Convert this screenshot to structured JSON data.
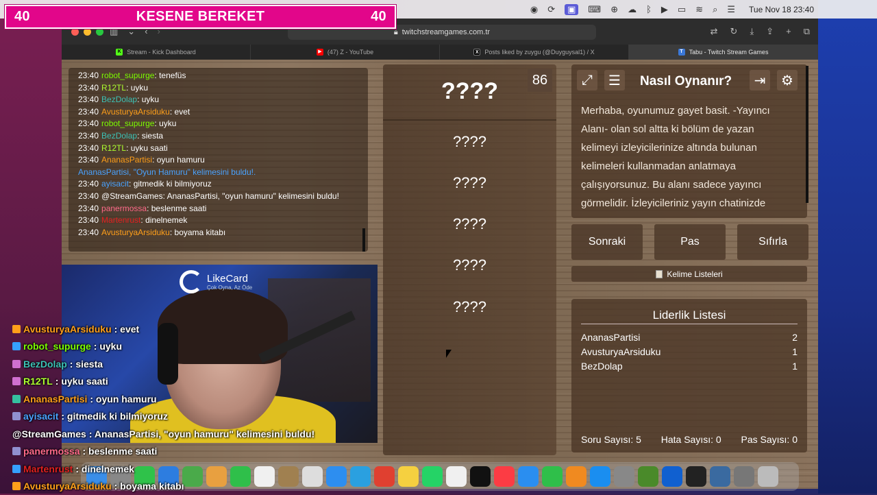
{
  "menubar": {
    "icons": [
      "app-icon",
      "sync-icon",
      "screen-icon",
      "keyboard-icon",
      "globe-icon",
      "cloud-icon",
      "bluetooth-icon",
      "play-icon",
      "battery-icon",
      "wifi-icon",
      "search-icon",
      "control-center-icon"
    ],
    "clock": "Tue Nov 18  23:40"
  },
  "banner": {
    "left_count": "40",
    "title": "KESENE BEREKET",
    "right_count": "40",
    "color": "#e2068a"
  },
  "browser": {
    "url": "twitchstreamgames.com.tr",
    "tabs": [
      {
        "label": "Stream - Kick Dashboard",
        "icon": "kick-icon",
        "color": "#53fc18",
        "active": false
      },
      {
        "label": "(47) Z - YouTube",
        "icon": "youtube-icon",
        "color": "#ff0000",
        "active": false
      },
      {
        "label": "Posts liked by zuygu (@Duyguysal1) / X",
        "icon": "x-icon",
        "color": "#000000",
        "active": false
      },
      {
        "label": "Tabu - Twitch Stream Games",
        "icon": "tabu-icon",
        "color": "#3a78d8",
        "active": true
      }
    ]
  },
  "chat_log": [
    {
      "time": "23:40",
      "user": "robot_supurge",
      "color": "#7cfc00",
      "msg": "tenefüs"
    },
    {
      "time": "23:40",
      "user": "R12TL",
      "color": "#adff2f",
      "msg": "uyku"
    },
    {
      "time": "23:40",
      "user": "BezDolap",
      "color": "#3cc1b5",
      "msg": "uyku"
    },
    {
      "time": "23:40",
      "user": "AvusturyaArsiduku",
      "color": "#ff9f1a",
      "msg": "evet"
    },
    {
      "time": "23:40",
      "user": "robot_supurge",
      "color": "#7cfc00",
      "msg": "uyku"
    },
    {
      "time": "23:40",
      "user": "BezDolap",
      "color": "#3cc1b5",
      "msg": "siesta"
    },
    {
      "time": "23:40",
      "user": "R12TL",
      "color": "#adff2f",
      "msg": "uyku saati"
    },
    {
      "time": "23:40",
      "user": "AnanasPartisi",
      "color": "#ff9f1a",
      "msg": "oyun hamuru"
    },
    {
      "time": "",
      "user": "AnanasPartisi, \"Oyun Hamuru\" kelimesini buldu!.",
      "color": "#4aa3ff",
      "msg": ""
    },
    {
      "time": "23:40",
      "user": "ayisacit",
      "color": "#4aa3ff",
      "msg": "gitmedik ki bilmiyoruz"
    },
    {
      "time": "23:40",
      "user": "@StreamGames",
      "color": "#ffffff",
      "msg": "AnanasPartisi, \"oyun hamuru\" kelimesini buldu!"
    },
    {
      "time": "23:40",
      "user": "panermossa",
      "color": "#ff6a8a",
      "msg": "beslenme saati"
    },
    {
      "time": "23:40",
      "user": "Martenrust",
      "color": "#e02020",
      "msg": "dinelnemek"
    },
    {
      "time": "23:40",
      "user": "AvusturyaArsiduku",
      "color": "#ff9f1a",
      "msg": "boyama kitabı"
    }
  ],
  "cam": {
    "logo_title": "LikeCard",
    "logo_sub": "Çok Oyna, Az Öde"
  },
  "game": {
    "timer": "86",
    "main_word": "????",
    "forbidden": [
      "????",
      "????",
      "????",
      "????",
      "????"
    ]
  },
  "howto": {
    "title": "Nasıl Oynanır?",
    "text": "Merhaba, oyunumuz gayet basit. -Yayıncı Alanı- olan sol altta ki bölüm de yazan kelimeyi izleyicilerinize altında bulunan kelimeleri kullanmadan anlatmaya çalışıyorsunuz. Bu alanı sadece yayıncı görmelidir. İzleyicileriniz yayın chatinizde tahmin ederler."
  },
  "buttons": {
    "next": "Sonraki",
    "pass": "Pas",
    "reset": "Sıfırla",
    "lists": "Kelime Listeleri"
  },
  "leaderboard": {
    "title": "Liderlik Listesi",
    "rows": [
      {
        "name": "AnanasPartisi",
        "score": "2"
      },
      {
        "name": "AvusturyaArsiduku",
        "score": "1"
      },
      {
        "name": "BezDolap",
        "score": "1"
      }
    ],
    "question_count": "Soru Sayısı: 5",
    "error_count": "Hata Sayısı: 0",
    "pass_count": "Pas Sayısı: 0"
  },
  "overlay_chat": [
    {
      "user": "AvusturyaArsiduku",
      "color": "#ff9f1a",
      "msg": ": evet",
      "badge": "#ff9f1a"
    },
    {
      "user": "robot_supurge",
      "color": "#7cfc00",
      "msg": ": uyku",
      "badge": "#35a0ff"
    },
    {
      "user": "BezDolap",
      "color": "#3cc1b5",
      "msg": ": siesta",
      "badge": "#d070d0"
    },
    {
      "user": "R12TL",
      "color": "#adff2f",
      "msg": ": uyku saati",
      "badge": "#d070d0"
    },
    {
      "user": "AnanasPartisi",
      "color": "#ff9f1a",
      "msg": ": oyun hamuru",
      "badge": "#35c0a0"
    },
    {
      "user": "ayisacit",
      "color": "#4aa3ff",
      "msg": ": gitmedik ki bilmiyoruz",
      "badge": "#9090d0"
    },
    {
      "user": "@StreamGames",
      "color": "#ffffff",
      "msg": ": AnanasPartisi, \"oyun hamuru\" kelimesini buldu!",
      "badge": ""
    },
    {
      "user": "panermossa",
      "color": "#ff6a8a",
      "msg": ": beslenme saati",
      "badge": "#9090d0"
    },
    {
      "user": "Martenrust",
      "color": "#e02020",
      "msg": ": dinelnemek",
      "badge": "#35a0ff"
    },
    {
      "user": "AvusturyaArsiduku",
      "color": "#ff9f1a",
      "msg": ": boyama kitabı",
      "badge": "#ff9f1a"
    }
  ],
  "dock": [
    {
      "name": "finder-icon",
      "color": "#3a8ee8"
    },
    {
      "name": "launchpad-icon",
      "color": "#888"
    },
    {
      "name": "messages-icon",
      "color": "#2fc24a"
    },
    {
      "name": "mail-icon",
      "color": "#2d7de0"
    },
    {
      "name": "maps-icon",
      "color": "#4aaa4a"
    },
    {
      "name": "photos-icon",
      "color": "#e8a040"
    },
    {
      "name": "facetime-icon",
      "color": "#2fbf4a"
    },
    {
      "name": "calendar-icon",
      "color": "#f0f0f0"
    },
    {
      "name": "notes-app-icon",
      "color": "#a08050"
    },
    {
      "name": "reminders-icon",
      "color": "#ddd"
    },
    {
      "name": "safari-icon",
      "color": "#2d8ef0"
    },
    {
      "name": "telegram-icon",
      "color": "#2aa0e0"
    },
    {
      "name": "chrome-icon",
      "color": "#e04030"
    },
    {
      "name": "notes-icon",
      "color": "#f5d040"
    },
    {
      "name": "whatsapp-icon",
      "color": "#25d366"
    },
    {
      "name": "freeform-icon",
      "color": "#f0f0f0"
    },
    {
      "name": "appletv-icon",
      "color": "#111"
    },
    {
      "name": "music-icon",
      "color": "#fc3c44"
    },
    {
      "name": "keynote-icon",
      "color": "#2a8ef0"
    },
    {
      "name": "numbers-icon",
      "color": "#2fbf4a"
    },
    {
      "name": "pages-icon",
      "color": "#f08a20"
    },
    {
      "name": "appstore-icon",
      "color": "#1a8ef0"
    },
    {
      "name": "settings-icon",
      "color": "#888"
    },
    {
      "name": "xcode-icon",
      "color": "#4a8a2a"
    },
    {
      "name": "wd-icon",
      "color": "#1060d0"
    },
    {
      "name": "obs-icon",
      "color": "#222"
    },
    {
      "name": "quicktime-icon",
      "color": "#3a6aa0"
    },
    {
      "name": "preview-icon",
      "color": "#777"
    },
    {
      "name": "trash-icon",
      "color": "#bbb"
    }
  ]
}
